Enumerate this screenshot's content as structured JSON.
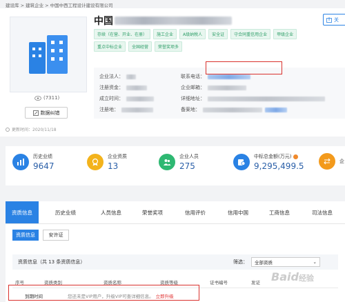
{
  "breadcrumb": "建设库 > 建筑企业 > 中国中西工程设计建设有限公司",
  "company": {
    "title_prefix": "中国",
    "tags": [
      "存续（在营、开业、在册）",
      "施工企业",
      "A级纳税人",
      "安全证",
      "守合同重信用企业",
      "甲级企业",
      "重点中标企业",
      "全国经营",
      "荣誉奖项多"
    ],
    "fields": {
      "legal_rep": "企业法人：",
      "reg_capital": "注册资金：",
      "founded": "成立时间：",
      "reg_place": "注册地：",
      "phone": "联系电话：",
      "email": "企业邮箱：",
      "address": "详细地址：",
      "record": "备案地："
    },
    "views": "(7311)",
    "error_button": "数据纠错",
    "updated": "更新时间：2020/11/18",
    "follow": "关"
  },
  "stats": [
    {
      "label": "历史业绩",
      "value": "9647",
      "icon": "bar-chart-icon",
      "color": "#2a82e4"
    },
    {
      "label": "企业资质",
      "value": "13",
      "icon": "badge-icon",
      "color": "#f3b31c"
    },
    {
      "label": "企业人员",
      "value": "275",
      "icon": "people-icon",
      "color": "#2eb872"
    },
    {
      "label": "中标总金额(万元)",
      "value": "9,295,499.5",
      "icon": "money-icon",
      "color": "#2a82e4"
    },
    {
      "label": "企",
      "value": "",
      "icon": "transfer-icon",
      "color": "#f39a1c"
    }
  ],
  "tabs": [
    "资质信息",
    "历史业绩",
    "人员信息",
    "荣誉奖项",
    "信用评价",
    "信用中国",
    "工商信息",
    "司法信息"
  ],
  "subtabs": [
    "资质信息",
    "安许证"
  ],
  "section": {
    "title": "资质信息（共 13 条资质信息）",
    "filter_label": "筛选：",
    "filter_value": "全部资质"
  },
  "table": {
    "headers": [
      "序号",
      "资质类别",
      "资质名称",
      "资质等级",
      "证书编号",
      "发证"
    ],
    "vip_label": "到期时间",
    "vip_message": "您还未是VIP用户，升级VIP可查详细信息。",
    "vip_link": "立即升级"
  },
  "watermark": {
    "main": "Baid",
    "sub": "经验"
  }
}
